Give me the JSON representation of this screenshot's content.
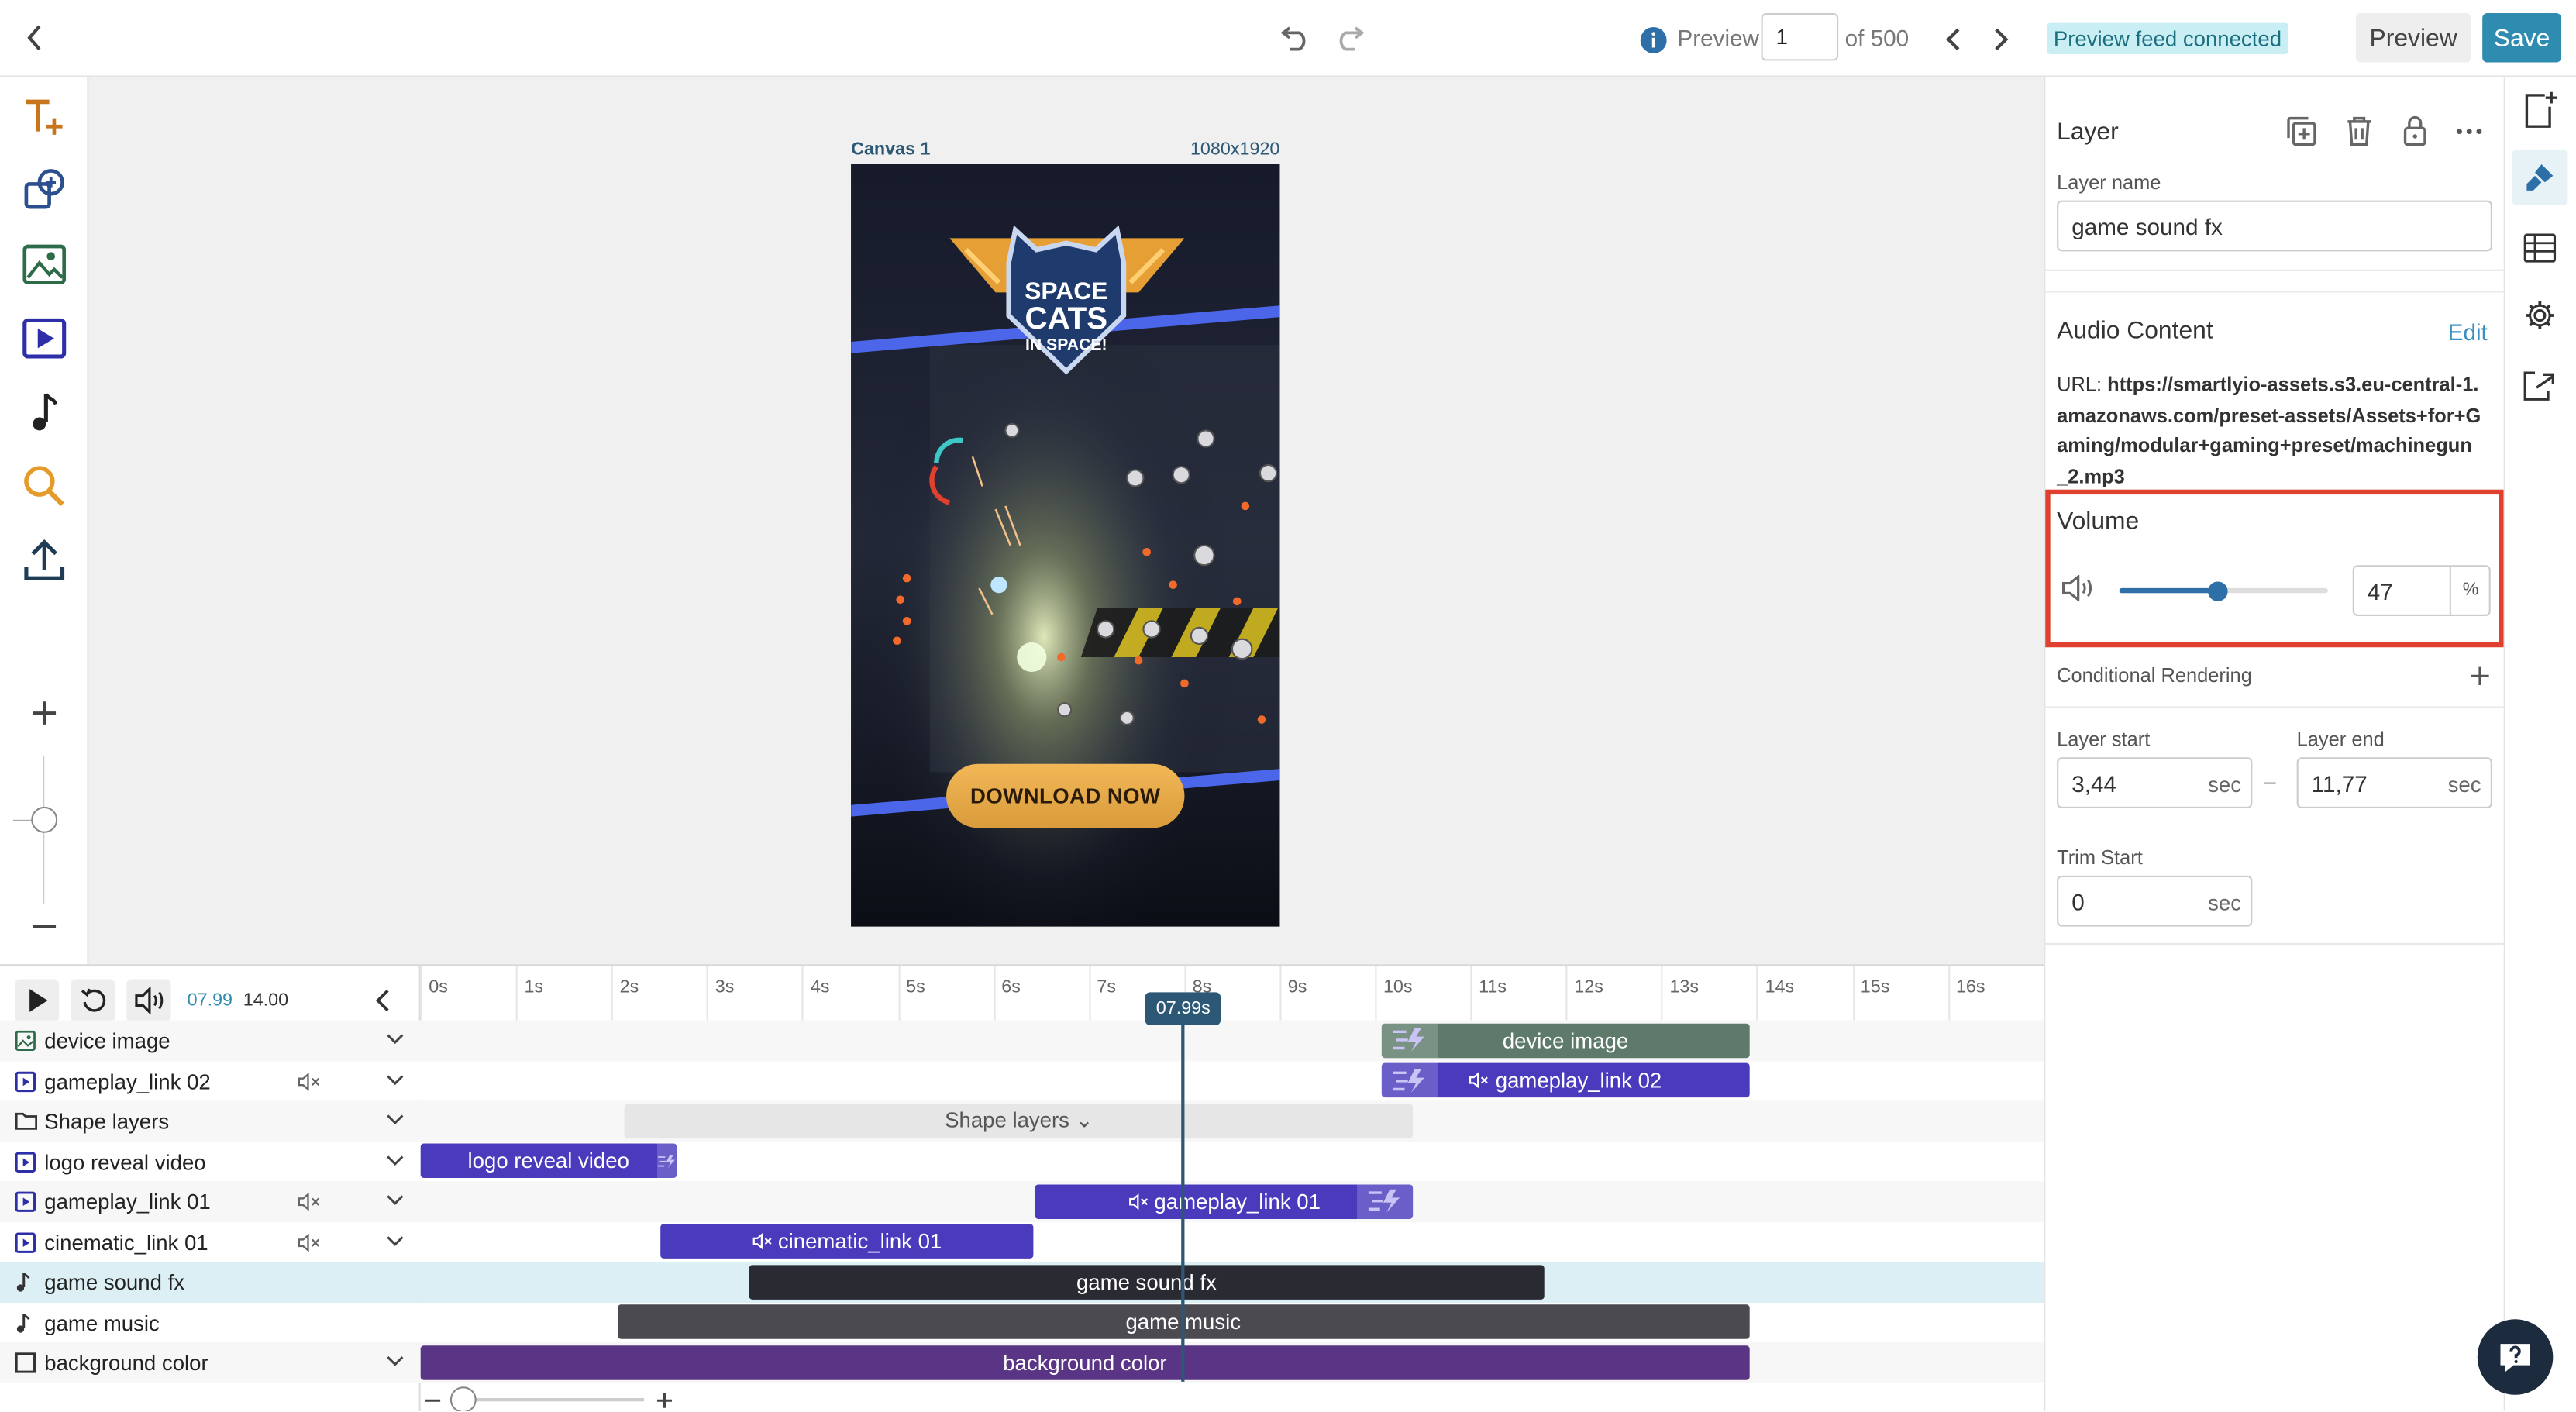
{
  "topbar": {
    "preview_label": "Preview",
    "page_value": "1",
    "page_of": "of 500",
    "feed_status": "Preview feed connected",
    "preview_button": "Preview",
    "save_button": "Save"
  },
  "canvas": {
    "name": "Canvas 1",
    "size": "1080x1920",
    "logo_line1": "SPACE",
    "logo_line2": "CATS",
    "logo_line3": "IN SPACE!",
    "cta": "DOWNLOAD NOW"
  },
  "panel": {
    "title": "Layer",
    "layer_name_label": "Layer name",
    "layer_name_value": "game sound fx",
    "audio_title": "Audio Content",
    "audio_edit": "Edit",
    "url_label": "URL:",
    "url_lines": [
      "https://smartlyio-assets.s3.eu-central-1.",
      "amazonaws.com/preset-assets/Assets+for+G",
      "aming/modular+gaming+preset/machinegun",
      "_2.mp3"
    ],
    "volume_title": "Volume",
    "volume_value": "47",
    "volume_fraction": 0.47,
    "volume_unit": "%",
    "conditional": "Conditional Rendering",
    "layer_start_label": "Layer start",
    "layer_start_value": "3,44",
    "layer_end_label": "Layer end",
    "layer_end_value": "11,77",
    "trim_label": "Trim Start",
    "trim_value": "0",
    "sec": "sec",
    "dash": "–",
    "highlight_color": "#e0402e"
  },
  "timeline": {
    "current_time": "07.99",
    "total_time": "14.00",
    "playhead": "07.99s",
    "playhead_seconds": 7.99,
    "ticks": [
      "0s",
      "1s",
      "2s",
      "3s",
      "4s",
      "5s",
      "6s",
      "7s",
      "8s",
      "9s",
      "10s",
      "11s",
      "12s",
      "13s",
      "14s",
      "15s",
      "16s"
    ],
    "layers": [
      {
        "name": "device image",
        "icon": "image-icon",
        "mute": false,
        "expand": true,
        "clip": {
          "label": "device image",
          "start": 10.07,
          "end": 13.92,
          "color": "#5d7a6a",
          "trans": true,
          "muted": false
        }
      },
      {
        "name": "gameplay_link 02",
        "icon": "video-icon",
        "mute": true,
        "expand": true,
        "clip": {
          "label": "gameplay_link 02",
          "start": 10.07,
          "end": 13.92,
          "color": "#4a3bbd",
          "trans": true,
          "muted": true
        }
      },
      {
        "name": "Shape layers",
        "icon": "folder-icon",
        "mute": false,
        "expand": true,
        "clip": {
          "label": "Shape layers ⌄",
          "start": 2.14,
          "end": 10.4,
          "color": "#e6e6e6",
          "text": "#555",
          "trans": false,
          "muted": false
        }
      },
      {
        "name": "logo reveal video",
        "icon": "video-icon",
        "mute": false,
        "expand": true,
        "clip": {
          "label": "logo reveal video",
          "start": 0.0,
          "end": 2.68,
          "color": "#4a3bbd",
          "trans": true,
          "muted": false
        }
      },
      {
        "name": "gameplay_link 01",
        "icon": "video-icon",
        "mute": true,
        "expand": true,
        "clip": {
          "label": "gameplay_link 01",
          "start": 6.44,
          "end": 10.4,
          "color": "#4a3bbd",
          "trans": true,
          "muted": true
        }
      },
      {
        "name": "cinematic_link 01",
        "icon": "video-icon",
        "mute": true,
        "expand": true,
        "clip": {
          "label": "cinematic_link 01",
          "start": 2.51,
          "end": 6.42,
          "color": "#4a3bbd",
          "trans": false,
          "muted": true
        }
      },
      {
        "name": "game sound fx",
        "icon": "music-icon",
        "mute": false,
        "expand": false,
        "selected": true,
        "clip": {
          "label": "game sound fx",
          "start": 3.44,
          "end": 11.77,
          "color": "#2a2a33",
          "trans": false,
          "muted": false
        }
      },
      {
        "name": "game music",
        "icon": "music-icon",
        "mute": false,
        "expand": false,
        "clip": {
          "label": "game music",
          "start": 2.06,
          "end": 13.92,
          "color": "#4a4a50",
          "trans": false,
          "muted": false
        }
      },
      {
        "name": "background color",
        "icon": "square-icon",
        "mute": false,
        "expand": true,
        "clip": {
          "label": "background color",
          "start": 0.0,
          "end": 13.92,
          "color": "#5a3585",
          "trans": false,
          "muted": false
        }
      }
    ]
  }
}
